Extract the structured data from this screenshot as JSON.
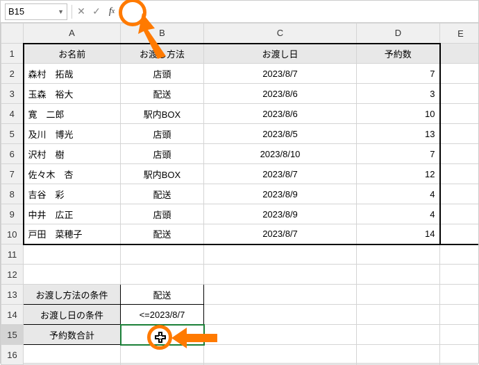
{
  "name_box": "B15",
  "formula_value": "",
  "col_headers": [
    "A",
    "B",
    "C",
    "D",
    "E"
  ],
  "row_headers": [
    "1",
    "2",
    "3",
    "4",
    "5",
    "6",
    "7",
    "8",
    "9",
    "10",
    "11",
    "12",
    "13",
    "14",
    "15",
    "16"
  ],
  "header": {
    "A": "お名前",
    "B": "お渡し方法",
    "C": "お渡し日",
    "D": "予約数"
  },
  "rows": [
    {
      "A": "森村　拓哉",
      "B": "店頭",
      "C": "2023/8/7",
      "D": "7"
    },
    {
      "A": "玉森　裕大",
      "B": "配送",
      "C": "2023/8/6",
      "D": "3"
    },
    {
      "A": "寛　二郎",
      "B": "駅内BOX",
      "C": "2023/8/6",
      "D": "10"
    },
    {
      "A": "及川　博光",
      "B": "店頭",
      "C": "2023/8/5",
      "D": "13"
    },
    {
      "A": "沢村　樹",
      "B": "店頭",
      "C": "2023/8/10",
      "D": "7"
    },
    {
      "A": "佐々木　杏",
      "B": "駅内BOX",
      "C": "2023/8/7",
      "D": "12"
    },
    {
      "A": "吉谷　彩",
      "B": "配送",
      "C": "2023/8/9",
      "D": "4"
    },
    {
      "A": "中井　広正",
      "B": "店頭",
      "C": "2023/8/9",
      "D": "4"
    },
    {
      "A": "戸田　菜穂子",
      "B": "配送",
      "C": "2023/8/7",
      "D": "14"
    }
  ],
  "cond": {
    "r13A": "お渡し方法の条件",
    "r13B": "配送",
    "r14A": "お渡し日の条件",
    "r14B": "<=2023/8/7",
    "r15A": "予約数合計",
    "r15B": ""
  }
}
